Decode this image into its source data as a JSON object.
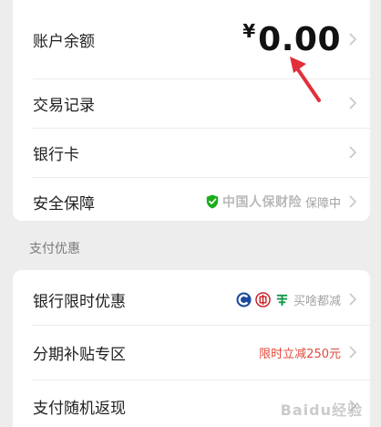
{
  "wallet": {
    "balance_label": "账户余额",
    "currency_symbol": "¥",
    "balance_value": "0.00",
    "transactions_label": "交易记录",
    "bank_card_label": "银行卡",
    "security_label": "安全保障",
    "insurer_name": "中国人保财险",
    "security_status": "保障中"
  },
  "discounts": {
    "section_title": "支付优惠",
    "bank_offer_label": "银行限时优惠",
    "bank_offer_text": "买啥都减",
    "installment_label": "分期补贴专区",
    "installment_text": "限时立减250元",
    "cashback_label": "支付随机返现"
  },
  "watermark_text": "Baidu经验",
  "colors": {
    "accent_red": "#e24a3d",
    "shield_green": "#1aad19",
    "card_bg": "#ffffff",
    "page_bg": "#ededed"
  },
  "icons": [
    "chevron-right-icon",
    "shield-check-icon",
    "bank-of-communications-icon",
    "icbc-icon",
    "china-post-icon"
  ]
}
